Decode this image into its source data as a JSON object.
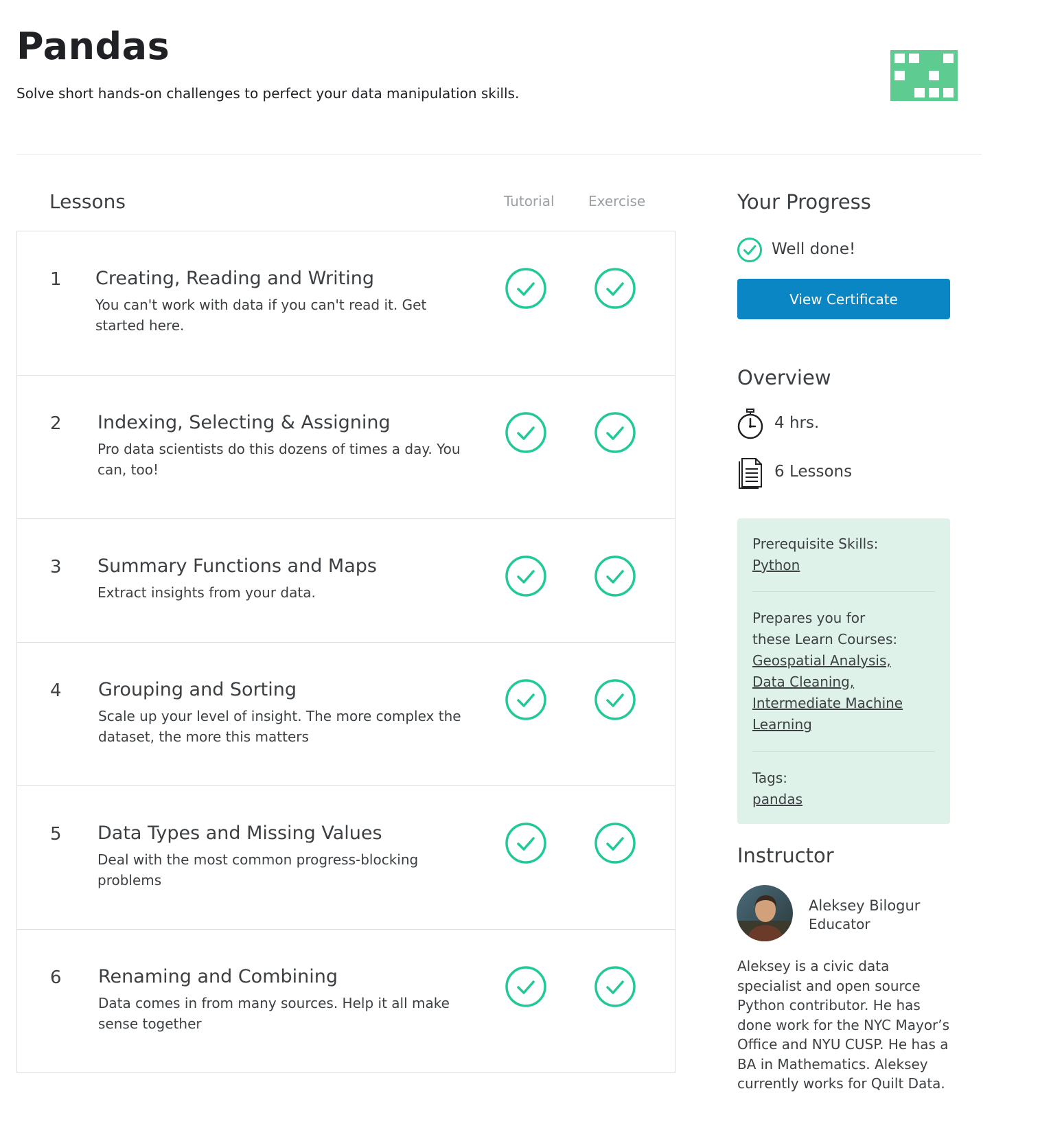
{
  "header": {
    "title": "Pandas",
    "subtitle": "Solve short hands-on challenges to perfect your data manipulation skills."
  },
  "lessons": {
    "heading": "Lessons",
    "col_tutorial": "Tutorial",
    "col_exercise": "Exercise",
    "items": [
      {
        "number": "1",
        "title": "Creating, Reading and Writing",
        "description": "You can't work with data if you can't read it. Get started here.",
        "tutorial_done": true,
        "exercise_done": true
      },
      {
        "number": "2",
        "title": "Indexing, Selecting & Assigning",
        "description": "Pro data scientists do this dozens of times a day. You can, too!",
        "tutorial_done": true,
        "exercise_done": true
      },
      {
        "number": "3",
        "title": "Summary Functions and Maps",
        "description": "Extract insights from your data.",
        "tutorial_done": true,
        "exercise_done": true
      },
      {
        "number": "4",
        "title": "Grouping and Sorting",
        "description": "Scale up your level of insight. The more complex the dataset, the more this matters",
        "tutorial_done": true,
        "exercise_done": true
      },
      {
        "number": "5",
        "title": "Data Types and Missing Values",
        "description": "Deal with the most common progress-blocking problems",
        "tutorial_done": true,
        "exercise_done": true
      },
      {
        "number": "6",
        "title": "Renaming and Combining",
        "description": "Data comes in from many sources. Help it all make sense together",
        "tutorial_done": true,
        "exercise_done": true
      }
    ]
  },
  "progress": {
    "heading": "Your Progress",
    "status": "Well done!",
    "button_label": "View Certificate"
  },
  "overview": {
    "heading": "Overview",
    "duration": "4 hrs.",
    "lessons_count": "6 Lessons",
    "prereq_label": "Prerequisite Skills:",
    "prereq_link": "Python",
    "prepares_label_line1": "Prepares you for",
    "prepares_label_line2": "these Learn Courses:",
    "prepares_links": [
      "Geospatial Analysis,",
      "Data Cleaning,",
      "Intermediate Machine",
      "Learning"
    ],
    "tags_label": "Tags:",
    "tag": "pandas"
  },
  "instructor": {
    "heading": "Instructor",
    "name": "Aleksey Bilogur",
    "role": "Educator",
    "bio": "Aleksey is a civic data specialist and open source Python contributor. He has done work for the NYC Mayor’s Office and NYU CUSP. He has a BA in Mathematics. Aleksey currently works for Quilt Data."
  },
  "colors": {
    "accent_green": "#20c997",
    "button_blue": "#0a86c4",
    "logo_green": "#5ecb90",
    "info_box_bg": "#dff2e9"
  },
  "icons": {
    "logo": "pandas-grid-logo",
    "check": "check-circle-icon",
    "timer": "stopwatch-icon",
    "lessons": "document-icon"
  }
}
